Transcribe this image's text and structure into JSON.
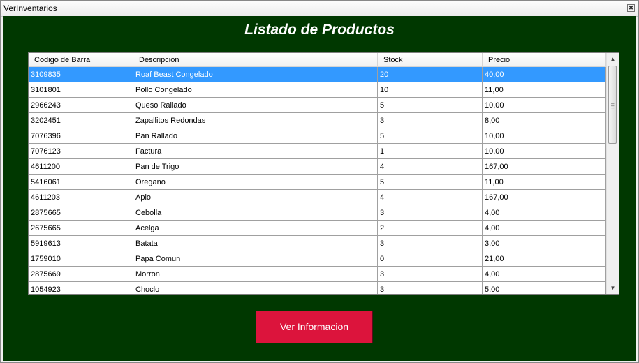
{
  "window": {
    "title": "VerInventarios",
    "close_glyph": "✖"
  },
  "heading": "Listado de Productos",
  "table": {
    "columns": [
      "Codigo de Barra",
      "Descripcion",
      "Stock",
      "Precio"
    ],
    "selected_row": 0,
    "rows": [
      [
        "3109835",
        "Roaf Beast Congelado",
        "20",
        "40,00"
      ],
      [
        "3101801",
        "Pollo Congelado",
        "10",
        "11,00"
      ],
      [
        "2966243",
        "Queso Rallado",
        "5",
        "10,00"
      ],
      [
        "3202451",
        "Zapallitos Redondas",
        "3",
        "8,00"
      ],
      [
        "7076396",
        "Pan Rallado",
        "5",
        "10,00"
      ],
      [
        "7076123",
        "Factura",
        "1",
        "10,00"
      ],
      [
        "4611200",
        "Pan de Trigo",
        "4",
        "167,00"
      ],
      [
        "5416061",
        "Oregano",
        "5",
        "11,00"
      ],
      [
        "4611203",
        "Apio",
        "4",
        "167,00"
      ],
      [
        "2875665",
        "Cebolla",
        "3",
        "4,00"
      ],
      [
        "2675665",
        "Acelga",
        "2",
        "4,00"
      ],
      [
        "5919613",
        "Batata",
        "3",
        "3,00"
      ],
      [
        "1759010",
        "Papa Comun",
        "0",
        "21,00"
      ],
      [
        "2875669",
        "Morron",
        "3",
        "4,00"
      ],
      [
        "1054923",
        "Choclo",
        "3",
        "5,00"
      ]
    ]
  },
  "scrollbar": {
    "up_glyph": "▲",
    "down_glyph": "▼"
  },
  "button": {
    "label": "Ver Informacion"
  },
  "colors": {
    "background": "#003800",
    "selection": "#3399ff",
    "button": "#dc143c"
  }
}
